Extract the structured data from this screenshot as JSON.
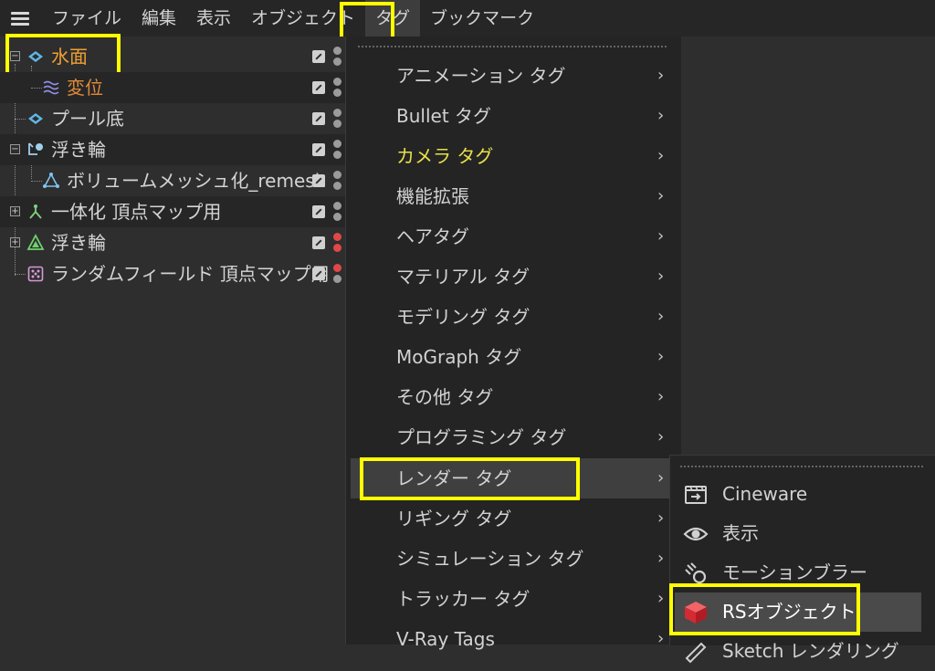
{
  "menubar": {
    "items": [
      "ファイル",
      "編集",
      "表示",
      "オブジェクト",
      "タグ",
      "ブックマーク"
    ]
  },
  "tree": {
    "rows": [
      {
        "label": "水面"
      },
      {
        "label": "変位"
      },
      {
        "label": "プール底"
      },
      {
        "label": "浮き輪"
      },
      {
        "label": "ボリュームメッシュ化_remesh"
      },
      {
        "label": "一体化 頂点マップ用"
      },
      {
        "label": "浮き輪"
      },
      {
        "label": "ランダムフィールド 頂点マップ用"
      }
    ]
  },
  "tag_menu": {
    "items": [
      {
        "label": "アニメーション タグ",
        "chevron": "›"
      },
      {
        "label": "Bullet タグ",
        "chevron": "›"
      },
      {
        "label": "カメラ タグ",
        "chevron": "›"
      },
      {
        "label": "機能拡張",
        "chevron": "›"
      },
      {
        "label": "ヘアタグ",
        "chevron": "›"
      },
      {
        "label": "マテリアル タグ",
        "chevron": "›"
      },
      {
        "label": "モデリング タグ",
        "chevron": "›"
      },
      {
        "label": "MoGraph タグ",
        "chevron": "›"
      },
      {
        "label": "その他 タグ",
        "chevron": "›"
      },
      {
        "label": "プログラミング タグ",
        "chevron": "›"
      },
      {
        "label": "レンダー タグ",
        "chevron": "›"
      },
      {
        "label": "リギング タグ",
        "chevron": "›"
      },
      {
        "label": "シミュレーション タグ",
        "chevron": "›"
      },
      {
        "label": "トラッカー タグ",
        "chevron": "›"
      },
      {
        "label": "V-Ray Tags",
        "chevron": "›"
      }
    ]
  },
  "render_submenu": {
    "items": [
      {
        "label": "Cineware",
        "icon": "cineware-icon"
      },
      {
        "label": "表示",
        "icon": "eye-icon"
      },
      {
        "label": "モーションブラー",
        "icon": "motion-blur-icon"
      },
      {
        "label": "RSオブジェクト",
        "icon": "redshift-cube-icon"
      },
      {
        "label": "Sketch レンダリング",
        "icon": "sketch-render-icon"
      }
    ]
  },
  "colors": {
    "highlight": "#ffff00",
    "active_object": "#f0a030",
    "camera_tag_text": "#e6e14a",
    "redshift_red": "#e0323a"
  }
}
